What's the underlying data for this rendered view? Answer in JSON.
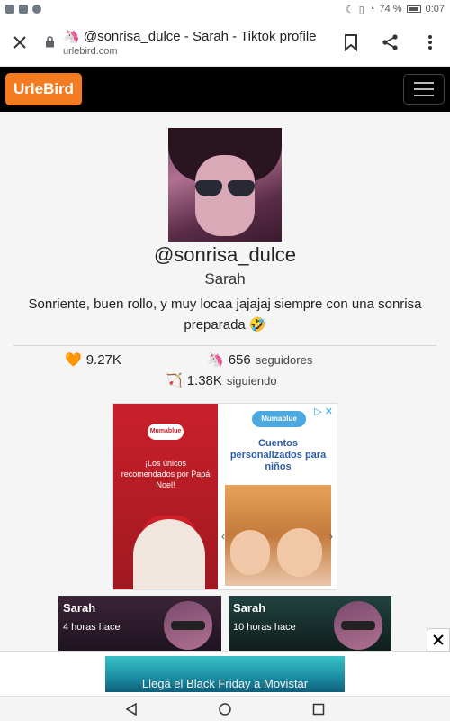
{
  "status_bar": {
    "battery_percent": "74 %",
    "time": "0:07"
  },
  "browser": {
    "page_title": "@sonrisa_dulce - Sarah - Tiktok profile",
    "title_emoji": "🦄",
    "host": "urlebird.com"
  },
  "site": {
    "logo": "UrleBird"
  },
  "profile": {
    "handle": "@sonrisa_dulce",
    "name": "Sarah",
    "bio": "Sonriente, buen rollo, y muy locaa jajajaj siempre con una sonrisa preparada 🤣",
    "likes_emoji": "🧡",
    "likes": "9.27K",
    "followers_emoji": "🦄",
    "followers": "656",
    "followers_label": "seguidores",
    "following_emoji": "🏹",
    "following": "1.38K",
    "following_label": "siguiendo"
  },
  "ad": {
    "left_brand": "Mumablue",
    "left_text": "¡Los únicos recomendados por Papá Noel!",
    "right_brand": "Mumablue",
    "right_text": "Cuentos personalizados para niños"
  },
  "videos": [
    {
      "name": "Sarah",
      "time": "4 horas hace"
    },
    {
      "name": "Sarah",
      "time": "10 horas hace"
    }
  ],
  "banner": {
    "text": "Llegá el Black Friday a Movistar"
  },
  "colors": {
    "logo_orange": "#f47b20",
    "header_black": "#000000"
  }
}
